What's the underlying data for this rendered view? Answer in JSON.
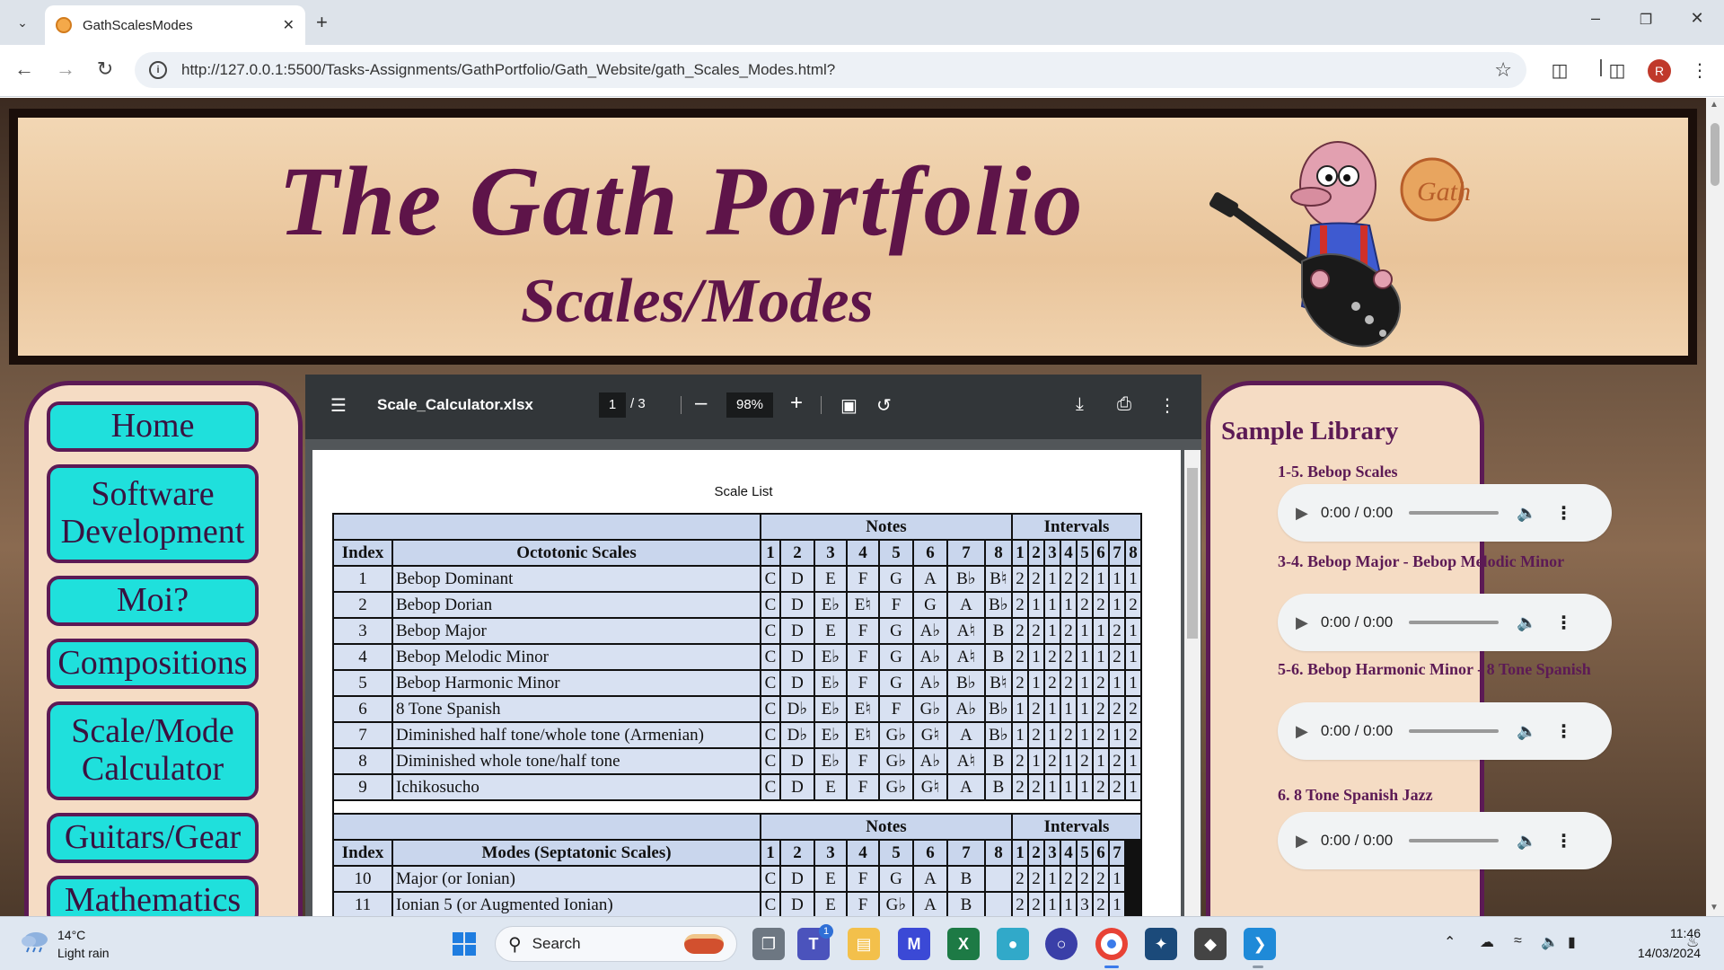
{
  "browser": {
    "tab_title": "GathScalesModes",
    "tab_close": "✕",
    "new_tab": "+",
    "url": "http://127.0.0.1:5500/Tasks-Assignments/GathPortfolio/Gath_Website/gath_Scales_Modes.html?",
    "profile_initial": "R"
  },
  "banner": {
    "title": "The Gath Portfolio",
    "subtitle": "Scales/Modes",
    "logo_text": "Gath"
  },
  "nav": {
    "items": [
      {
        "label": "Home"
      },
      {
        "label": "Software Development"
      },
      {
        "label": "Moi?"
      },
      {
        "label": "Compositions"
      },
      {
        "label": "Scale/Mode Calculator"
      },
      {
        "label": "Guitars/Gear"
      },
      {
        "label": "Mathematics"
      }
    ]
  },
  "pdf": {
    "filename": "Scale_Calculator.xlsx",
    "page_current": "1",
    "page_total": "/  3",
    "zoom": "98%",
    "sheet_title": "Scale List",
    "octo": {
      "group_notes": "Notes",
      "group_intervals": "Intervals",
      "col_index": "Index",
      "col_name": "Octotonic Scales",
      "note_cols": [
        "1",
        "2",
        "3",
        "4",
        "5",
        "6",
        "7",
        "8"
      ],
      "int_cols": [
        "1",
        "2",
        "3",
        "4",
        "5",
        "6",
        "7",
        "8"
      ],
      "rows": [
        {
          "idx": "1",
          "name": "Bebop Dominant",
          "notes": [
            "C",
            "D",
            "E",
            "F",
            "G",
            "A",
            "B♭",
            "B♮"
          ],
          "ints": [
            "2",
            "2",
            "1",
            "2",
            "2",
            "1",
            "1",
            "1"
          ]
        },
        {
          "idx": "2",
          "name": "Bebop Dorian",
          "notes": [
            "C",
            "D",
            "E♭",
            "E♮",
            "F",
            "G",
            "A",
            "B♭"
          ],
          "ints": [
            "2",
            "1",
            "1",
            "1",
            "2",
            "2",
            "1",
            "2"
          ]
        },
        {
          "idx": "3",
          "name": "Bebop Major",
          "notes": [
            "C",
            "D",
            "E",
            "F",
            "G",
            "A♭",
            "A♮",
            "B"
          ],
          "ints": [
            "2",
            "2",
            "1",
            "2",
            "1",
            "1",
            "2",
            "1"
          ]
        },
        {
          "idx": "4",
          "name": "Bebop Melodic Minor",
          "notes": [
            "C",
            "D",
            "E♭",
            "F",
            "G",
            "A♭",
            "A♮",
            "B"
          ],
          "ints": [
            "2",
            "1",
            "2",
            "2",
            "1",
            "1",
            "2",
            "1"
          ]
        },
        {
          "idx": "5",
          "name": "Bebop Harmonic Minor",
          "notes": [
            "C",
            "D",
            "E♭",
            "F",
            "G",
            "A♭",
            "B♭",
            "B♮"
          ],
          "ints": [
            "2",
            "1",
            "2",
            "2",
            "1",
            "2",
            "1",
            "1"
          ]
        },
        {
          "idx": "6",
          "name": "8 Tone Spanish",
          "notes": [
            "C",
            "D♭",
            "E♭",
            "E♮",
            "F",
            "G♭",
            "A♭",
            "B♭"
          ],
          "ints": [
            "1",
            "2",
            "1",
            "1",
            "1",
            "2",
            "2",
            "2"
          ]
        },
        {
          "idx": "7",
          "name": "Diminished half tone/whole tone (Armenian)",
          "notes": [
            "C",
            "D♭",
            "E♭",
            "E♮",
            "G♭",
            "G♮",
            "A",
            "B♭"
          ],
          "ints": [
            "1",
            "2",
            "1",
            "2",
            "1",
            "2",
            "1",
            "2"
          ]
        },
        {
          "idx": "8",
          "name": "Diminished whole tone/half tone",
          "notes": [
            "C",
            "D",
            "E♭",
            "F",
            "G♭",
            "A♭",
            "A♮",
            "B"
          ],
          "ints": [
            "2",
            "1",
            "2",
            "1",
            "2",
            "1",
            "2",
            "1"
          ]
        },
        {
          "idx": "9",
          "name": "Ichikosucho",
          "notes": [
            "C",
            "D",
            "E",
            "F",
            "G♭",
            "G♮",
            "A",
            "B"
          ],
          "ints": [
            "2",
            "2",
            "1",
            "1",
            "1",
            "2",
            "2",
            "1"
          ]
        }
      ]
    },
    "septa": {
      "group_notes": "Notes",
      "group_intervals": "Intervals",
      "col_index": "Index",
      "col_name": "Modes (Septatonic Scales)",
      "note_cols": [
        "1",
        "2",
        "3",
        "4",
        "5",
        "6",
        "7",
        "8"
      ],
      "int_cols": [
        "1",
        "2",
        "3",
        "4",
        "5",
        "6",
        "7"
      ],
      "rows": [
        {
          "idx": "10",
          "name": "Major (or Ionian)",
          "notes": [
            "C",
            "D",
            "E",
            "F",
            "G",
            "A",
            "B",
            ""
          ],
          "ints": [
            "2",
            "2",
            "1",
            "2",
            "2",
            "2",
            "1"
          ]
        },
        {
          "idx": "11",
          "name": "Ionian 5 (or Augmented Ionian)",
          "notes": [
            "C",
            "D",
            "E",
            "F",
            "G♭",
            "A",
            "B",
            ""
          ],
          "ints": [
            "2",
            "2",
            "1",
            "1",
            "3",
            "2",
            "1"
          ]
        }
      ]
    }
  },
  "library": {
    "title": "Sample Library",
    "items": [
      {
        "label": "1-5. Bebop Scales",
        "time": "0:00 / 0:00"
      },
      {
        "label": "3-4. Bebop Major - Bebop Melodic Minor",
        "time": "0:00 / 0:00"
      },
      {
        "label": "5-6. Bebop Harmonic Minor - 8 Tone Spanish",
        "time": "0:00 / 0:00"
      },
      {
        "label": "6. 8 Tone Spanish Jazz",
        "time": "0:00 / 0:00"
      }
    ]
  },
  "taskbar": {
    "temp": "14°C",
    "weather": "Light rain",
    "search": "Search",
    "teams_badge": "1",
    "time": "11:46",
    "date": "14/03/2024"
  }
}
